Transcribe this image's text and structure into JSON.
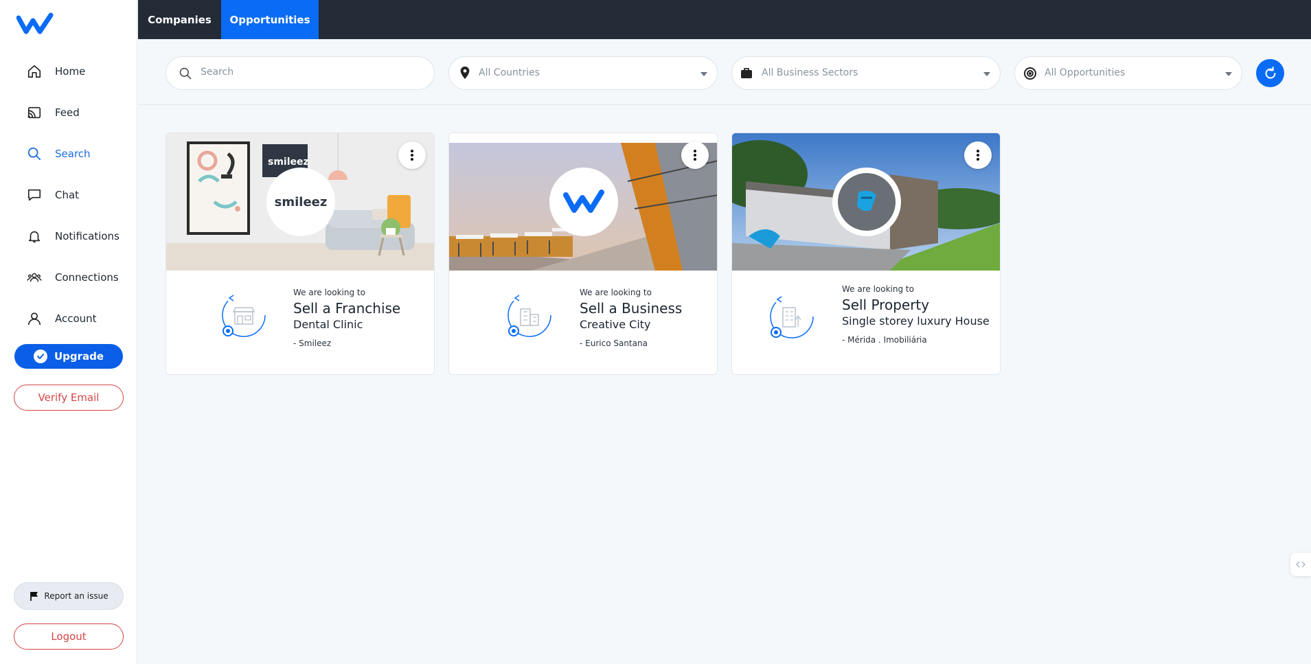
{
  "sidebar": {
    "items": [
      {
        "label": "Home",
        "icon": "home-icon"
      },
      {
        "label": "Feed",
        "icon": "cast-icon"
      },
      {
        "label": "Search",
        "icon": "search-icon",
        "active": true
      },
      {
        "label": "Chat",
        "icon": "chat-icon"
      },
      {
        "label": "Notifications",
        "icon": "bell-icon"
      },
      {
        "label": "Connections",
        "icon": "people-icon"
      },
      {
        "label": "Account",
        "icon": "user-icon"
      }
    ],
    "upgrade_label": "Upgrade",
    "verify_label": "Verify Email",
    "report_label": "Report an issue",
    "logout_label": "Logout"
  },
  "tabs": [
    {
      "label": "Companies",
      "active": false
    },
    {
      "label": "Opportunities",
      "active": true
    }
  ],
  "filters": {
    "search_placeholder": "Search",
    "countries": "All Countries",
    "sectors": "All Business Sectors",
    "opportunities": "All Opportunities"
  },
  "cards": [
    {
      "kicker": "We are looking to",
      "goal": "Sell a Franchise",
      "title": "Dental Clinic",
      "owner": "- Smileez",
      "logo_text": "smileez"
    },
    {
      "kicker": "We are looking to",
      "goal": "Sell a Business",
      "title": "Creative City",
      "owner": "- Eurico Santana"
    },
    {
      "kicker": "We are looking to",
      "goal": "Sell Property",
      "title": "Single storey luxury House",
      "owner": "- Mérida . Imobiliária"
    }
  ],
  "colors": {
    "accent": "#0a6cf5",
    "topbar": "#232b36",
    "danger": "#d64545"
  }
}
